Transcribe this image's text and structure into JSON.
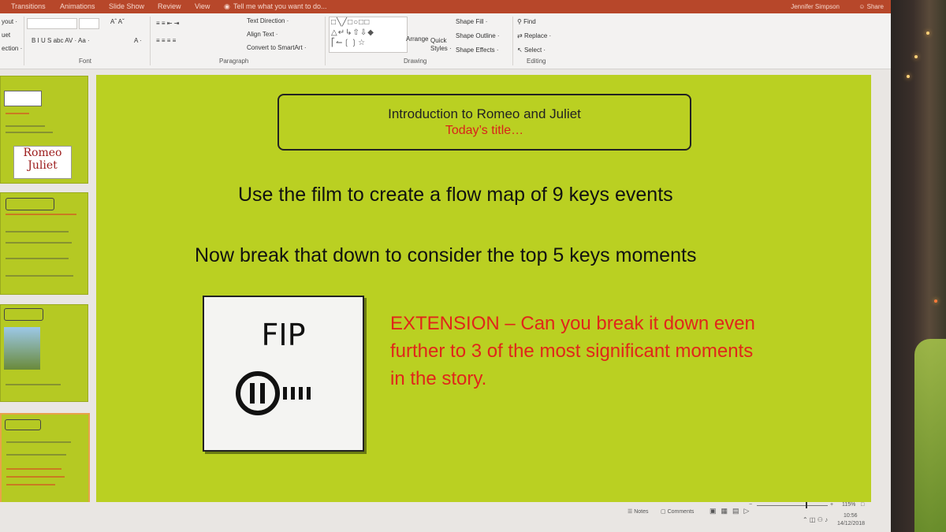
{
  "tabs": [
    "Transitions",
    "Animations",
    "Slide Show",
    "Review",
    "View"
  ],
  "tell_me": "Tell me what you want to do...",
  "user": "Jennifer Simpson",
  "share": "Share",
  "ribbon": {
    "groups": [
      "Font",
      "Paragraph",
      "Drawing",
      "Editing"
    ],
    "left_labels": [
      "yout ·",
      "uet",
      "ection ·"
    ],
    "font_buttons": "B  I  U  S  abc  AV ·  Aa ·",
    "paragraph": {
      "text_direction": "Text Direction ·",
      "align_text": "Align Text ·",
      "convert": "Convert to SmartArt ·"
    },
    "drawing": {
      "arrange": "Arrange",
      "quick_styles": "Quick Styles ·",
      "shape_fill": "Shape Fill ·",
      "shape_outline": "Shape Outline ·",
      "shape_effects": "Shape Effects ·"
    },
    "editing": {
      "find": "Find",
      "replace": "Replace ·",
      "select": "Select ·"
    }
  },
  "thumbnail_logo": [
    "Romeo",
    "Juliet"
  ],
  "slide": {
    "title": "Introduction to Romeo and Juliet",
    "subtitle": "Today’s title…",
    "line1": "Use the film to create a flow map of 9 keys events",
    "line2": "Now break that down to consider the top 5 keys moments",
    "fip_label": "FIP",
    "extension": "EXTENSION – Can you break it down even further to 3 of the most significant moments in the story."
  },
  "status": {
    "notes": "Notes",
    "comments": "Comments",
    "zoom": "115%",
    "time": "10:56",
    "date": "14/12/2018"
  },
  "colors": {
    "slide_bg": "#bad022",
    "accent_red": "#d8231a",
    "tab_bar": "#b7472a"
  }
}
